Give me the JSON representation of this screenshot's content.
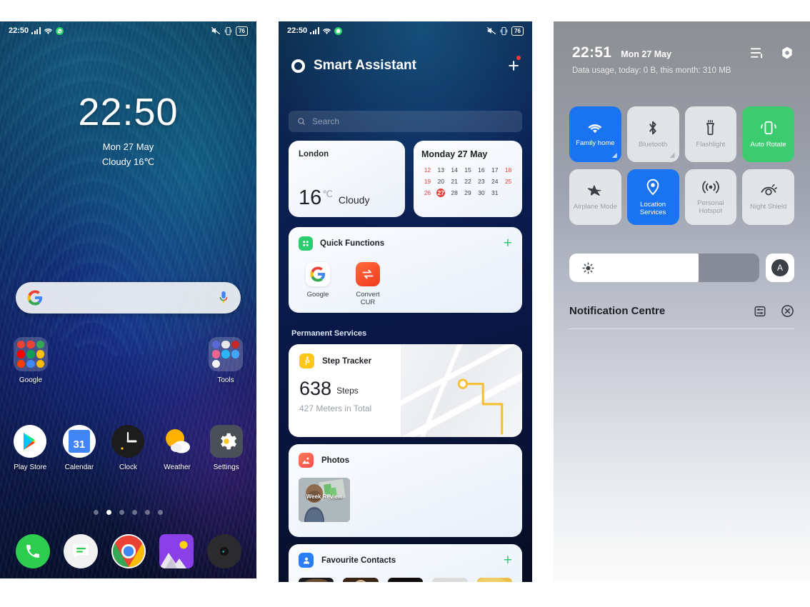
{
  "home": {
    "statusbar": {
      "time": "22:50",
      "battery": "76",
      "icons": [
        "signal-bars",
        "wifi",
        "whatsapp",
        "mute",
        "vibrate",
        "battery"
      ]
    },
    "clock_widget": {
      "time": "22:50",
      "date": "Mon 27 May",
      "weather": "Cloudy 16℃"
    },
    "search": {
      "placeholder": "",
      "left_icon": "google-g-icon",
      "right_icon": "microphone-icon"
    },
    "folders": [
      {
        "label": "Google",
        "colors": [
          "#ea4335",
          "#ea4335",
          "#34a853",
          "#ff0000",
          "#0f9d58",
          "#ffc107",
          "#ff3d00",
          "#4285f4",
          "#fbbc05"
        ]
      },
      {
        "label": "Tools",
        "colors": [
          "#5a67d8",
          "#e8e8e8",
          "#c62828",
          "#f06292",
          "#29b6f6",
          "#42a5f5",
          "#f5f5f5"
        ]
      }
    ],
    "apps": [
      {
        "label": "Play Store",
        "icon": "play-store-icon"
      },
      {
        "label": "Calendar",
        "icon": "calendar-icon",
        "day": "31"
      },
      {
        "label": "Clock",
        "icon": "clock-icon"
      },
      {
        "label": "Weather",
        "icon": "weather-icon"
      },
      {
        "label": "Settings",
        "icon": "settings-gear-icon"
      }
    ],
    "page_indicator": {
      "count": 6,
      "active": 2
    },
    "dock": [
      {
        "label": "Phone",
        "icon": "phone-icon"
      },
      {
        "label": "Messages",
        "icon": "messages-icon"
      },
      {
        "label": "Chrome",
        "icon": "chrome-icon"
      },
      {
        "label": "Gallery",
        "icon": "gallery-icon"
      },
      {
        "label": "Camera",
        "icon": "camera-icon"
      }
    ]
  },
  "assistant": {
    "statusbar": {
      "time": "22:50",
      "battery": "76"
    },
    "title": "Smart Assistant",
    "add_button": "+",
    "search": {
      "placeholder": "Search"
    },
    "weather_card": {
      "city": "London",
      "temp": "16",
      "unit": "℃",
      "condition": "Cloudy"
    },
    "calendar_card": {
      "header": "Monday 27 May",
      "days": [
        {
          "n": "12",
          "weekend": true
        },
        {
          "n": "13"
        },
        {
          "n": "14"
        },
        {
          "n": "15"
        },
        {
          "n": "16"
        },
        {
          "n": "17"
        },
        {
          "n": "18",
          "weekend": true
        },
        {
          "n": "19",
          "weekend": true
        },
        {
          "n": "20"
        },
        {
          "n": "21"
        },
        {
          "n": "22"
        },
        {
          "n": "23"
        },
        {
          "n": "24"
        },
        {
          "n": "25",
          "weekend": true
        },
        {
          "n": "26",
          "weekend": true
        },
        {
          "n": "27",
          "today": true
        },
        {
          "n": "28"
        },
        {
          "n": "29"
        },
        {
          "n": "30"
        },
        {
          "n": "31"
        },
        {
          "n": ""
        }
      ]
    },
    "quick_functions": {
      "title": "Quick Functions",
      "add": "+",
      "items": [
        {
          "label": "Google",
          "icon": "google-g-icon"
        },
        {
          "label": "Convert\nCUR",
          "label_line1": "Convert",
          "label_line2": "CUR",
          "icon": "convert-currency-icon"
        }
      ]
    },
    "section_title": "Permanent Services",
    "step_tracker": {
      "title": "Step Tracker",
      "steps": "638",
      "steps_unit": "Steps",
      "distance": "427 Meters in Total",
      "icon": "walking-person-icon"
    },
    "photos": {
      "title": "Photos",
      "thumb_caption": "Week Review",
      "icon": "photos-icon"
    },
    "favourite_contacts": {
      "title": "Favourite Contacts",
      "add": "+",
      "icon": "contacts-icon",
      "avatars": [
        "contact-1",
        "contact-2",
        "contact-3",
        "contact-placeholder",
        "contact-5"
      ]
    }
  },
  "control_centre": {
    "time": "22:51",
    "date": "Mon 27 May",
    "data_usage": "Data usage, today: 0 B, this month: 310 MB",
    "header_icons": [
      "edit-list-icon",
      "settings-gear-icon"
    ],
    "tiles": [
      {
        "label": "Family home",
        "icon": "wifi-icon",
        "state": "on-blue"
      },
      {
        "label": "Bluetooth",
        "icon": "bluetooth-icon",
        "state": "off"
      },
      {
        "label": "Flashlight",
        "icon": "flashlight-icon",
        "state": "off"
      },
      {
        "label": "Auto Rotate",
        "icon": "auto-rotate-icon",
        "state": "on-green"
      },
      {
        "label": "Airplane Mode",
        "icon": "airplane-icon",
        "state": "off"
      },
      {
        "label": "Location Services",
        "icon": "location-pin-icon",
        "state": "on-blue"
      },
      {
        "label": "Personal Hotspot",
        "icon": "hotspot-icon",
        "state": "off"
      },
      {
        "label": "Night Shield",
        "icon": "eye-shield-icon",
        "state": "off"
      }
    ],
    "brightness": {
      "icon": "brightness-sun-icon",
      "value": 68
    },
    "auto_brightness": "A",
    "notification_centre": {
      "title": "Notification Centre",
      "icons": [
        "notification-settings-icon",
        "clear-all-icon"
      ]
    }
  },
  "colors": {
    "accent_blue": "#1a73f0",
    "accent_green": "#3ccb6e",
    "red": "#e8413c",
    "tile_off": "#ecedef"
  }
}
